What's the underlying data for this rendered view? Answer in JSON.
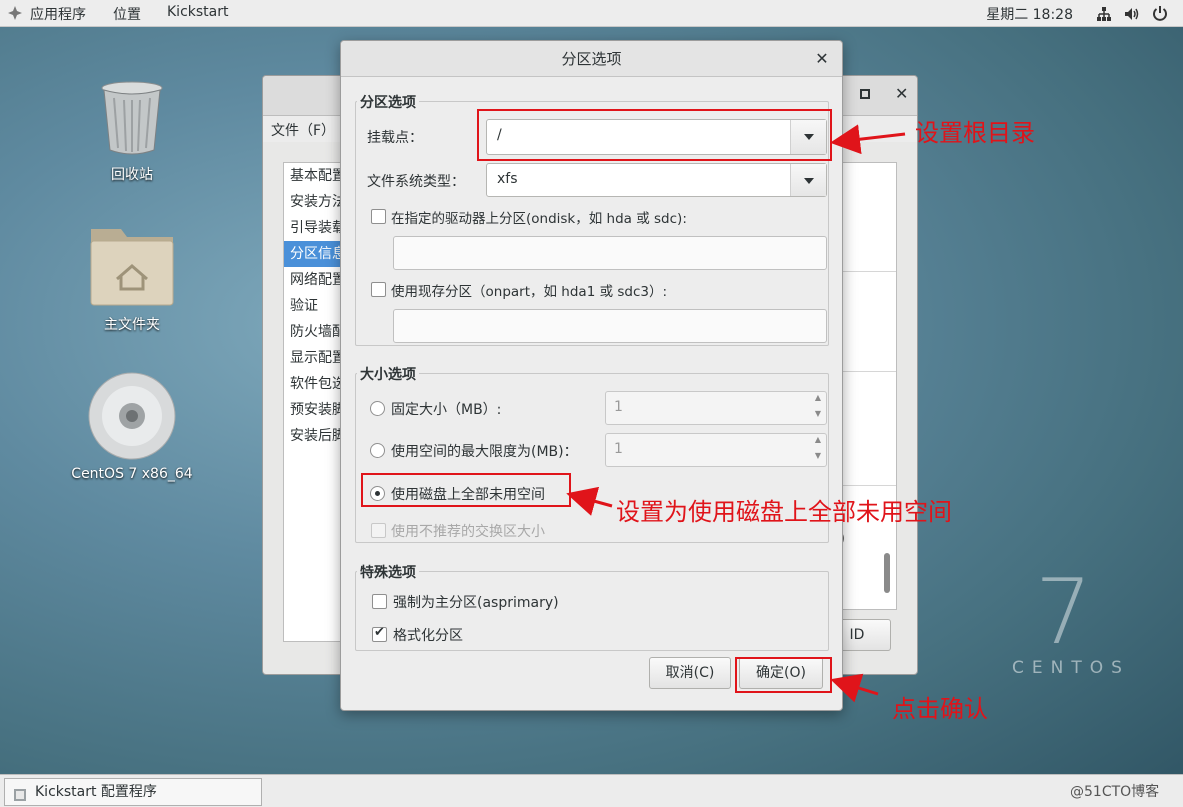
{
  "topbar": {
    "apps_menu": "应用程序",
    "places_menu": "位置",
    "app_name": "Kickstart",
    "clock": "星期二 18:28"
  },
  "desktop": {
    "icons": [
      {
        "label": "回收站",
        "icon": "trash-icon"
      },
      {
        "label": "主文件夹",
        "icon": "home-folder-icon"
      },
      {
        "label": "CentOS 7 x86_64",
        "icon": "dvd-icon"
      }
    ],
    "brand_number": "7",
    "brand_text": "CENTOS"
  },
  "bg_window": {
    "menu_file": "文件（F）",
    "sidebar": [
      "基本配置",
      "安装方法",
      "引导装载",
      "分区信息",
      "网络配置",
      "验证",
      "防火墙配置",
      "显示配置",
      "软件包选择",
      "预安装脚本",
      "安装后脚本"
    ],
    "selected_index": 3,
    "partial_text_b": "B)",
    "partial_button": "ID"
  },
  "dialog": {
    "title": "分区选项",
    "partition_section": {
      "legend": "分区选项",
      "mount_label": "挂载点：",
      "mount_value": "/",
      "fstype_label": "文件系统类型：",
      "fstype_value": "xfs",
      "ondisk_label": "在指定的驱动器上分区(ondisk，如 hda 或 sdc):",
      "ondisk_value": "",
      "onpart_label": "使用现存分区（onpart，如 hda1 或 sdc3）:",
      "onpart_value": ""
    },
    "size_section": {
      "legend": "大小选项",
      "fixed_label": "固定大小（MB）:",
      "fixed_value": "1",
      "max_label": "使用空间的最大限度为(MB)：",
      "max_value": "1",
      "fill_label": "使用磁盘上全部未用空间",
      "swap_label": "使用不推荐的交换区大小"
    },
    "special_section": {
      "legend": "特殊选项",
      "primary_label": "强制为主分区(asprimary)",
      "primary_checked": false,
      "format_label": "格式化分区",
      "format_checked": true
    },
    "cancel_label": "取消(C)",
    "ok_label": "确定(O)"
  },
  "annotations": {
    "set_root": "设置根目录",
    "use_all_space": "设置为使用磁盘上全部未用空间",
    "click_ok": "点击确认"
  },
  "taskbar": {
    "item": "Kickstart 配置程序"
  },
  "watermark": "@51CTO博客",
  "colors": {
    "annotation_red": "#e0141a",
    "selection_blue": "#4a90d9"
  }
}
